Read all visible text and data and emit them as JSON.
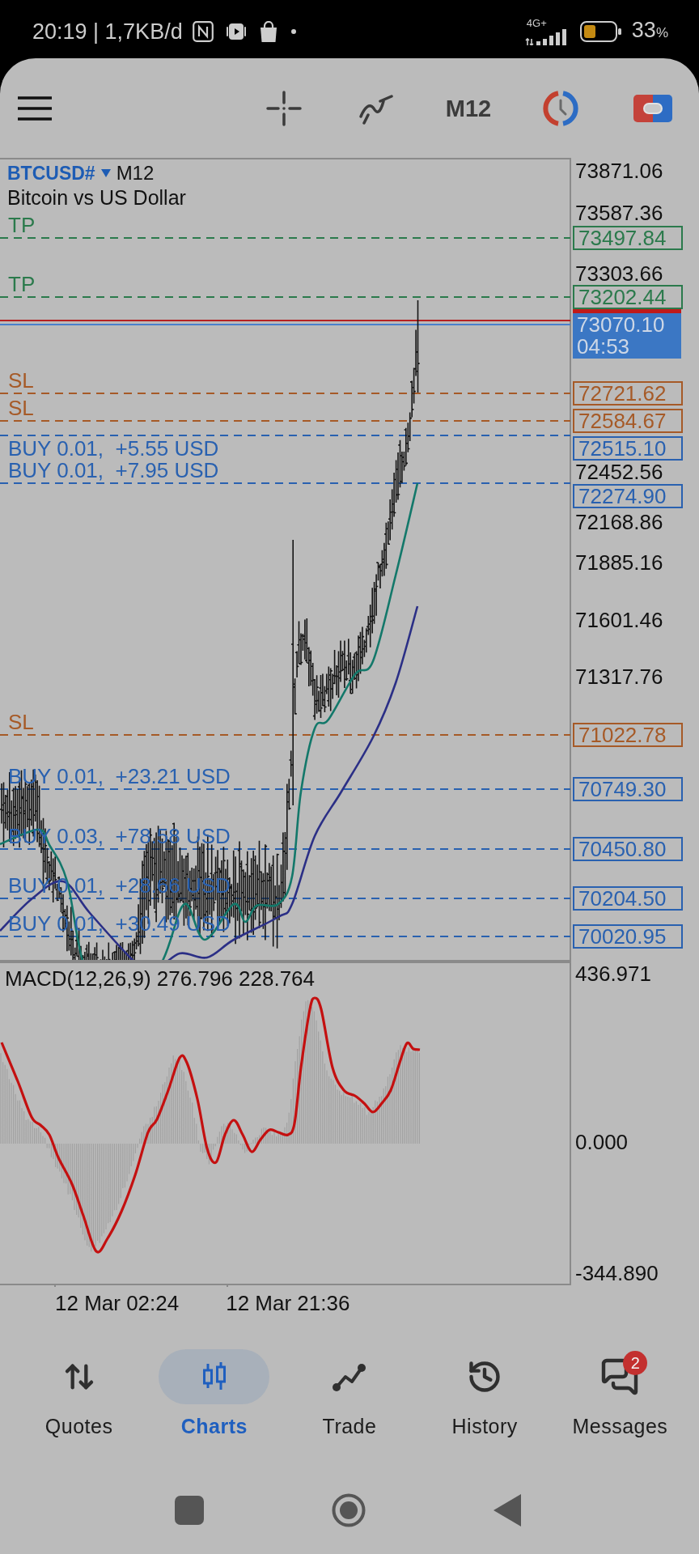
{
  "status_bar": {
    "text": "20:19 | 1,7KB/d",
    "network_type": "4G+",
    "battery_value": "33",
    "battery_unit": "%"
  },
  "toolbar": {
    "timeframe": "M12"
  },
  "chart": {
    "symbol": "BTCUSD#",
    "timeframe": "M12",
    "description": "Bitcoin vs US Dollar",
    "price_scale": [
      "73871.06",
      "73587.36",
      "73303.66",
      "72452.56",
      "72168.86",
      "71885.16",
      "71601.46",
      "71317.76"
    ],
    "orders": [
      {
        "kind": "tp",
        "label": "TP",
        "price": "73497.84"
      },
      {
        "kind": "tp",
        "label": "TP",
        "price": "73202.44"
      },
      {
        "kind": "sl",
        "label": "SL",
        "price": "72721.62"
      },
      {
        "kind": "sl",
        "label": "SL",
        "price": "72584.67"
      },
      {
        "kind": "buy",
        "label": "BUY 0.01,  +5.55 USD",
        "price": "72515.10"
      },
      {
        "kind": "buy",
        "label": "BUY 0.01,  +7.95 USD",
        "price": "72274.90"
      },
      {
        "kind": "sl",
        "label": "SL",
        "price": "71022.78"
      },
      {
        "kind": "buy",
        "label": "BUY 0.01,  +23.21 USD",
        "price": "70749.30"
      },
      {
        "kind": "buy",
        "label": "BUY 0.03,  +78.58 USD",
        "price": "70450.80"
      },
      {
        "kind": "buy",
        "label": "BUY 0.01,  +28.66 USD",
        "price": "70204.50"
      },
      {
        "kind": "buy",
        "label": "BUY 0.01,  +30.49 USD",
        "price": "70020.95"
      }
    ],
    "current_price": {
      "price": "73070.10",
      "timer": "04:53"
    }
  },
  "macd": {
    "label": "MACD(12,26,9) 276.796 228.764",
    "scale": [
      "436.971",
      "0.000",
      "-344.890"
    ]
  },
  "time_axis": [
    "12 Mar 02:24",
    "12 Mar 21:36"
  ],
  "bottom_nav": {
    "items": [
      {
        "label": "Quotes",
        "selected": false
      },
      {
        "label": "Charts",
        "selected": true
      },
      {
        "label": "Trade",
        "selected": false
      },
      {
        "label": "History",
        "selected": false
      },
      {
        "label": "Messages",
        "selected": false,
        "badge": "2"
      }
    ]
  }
}
